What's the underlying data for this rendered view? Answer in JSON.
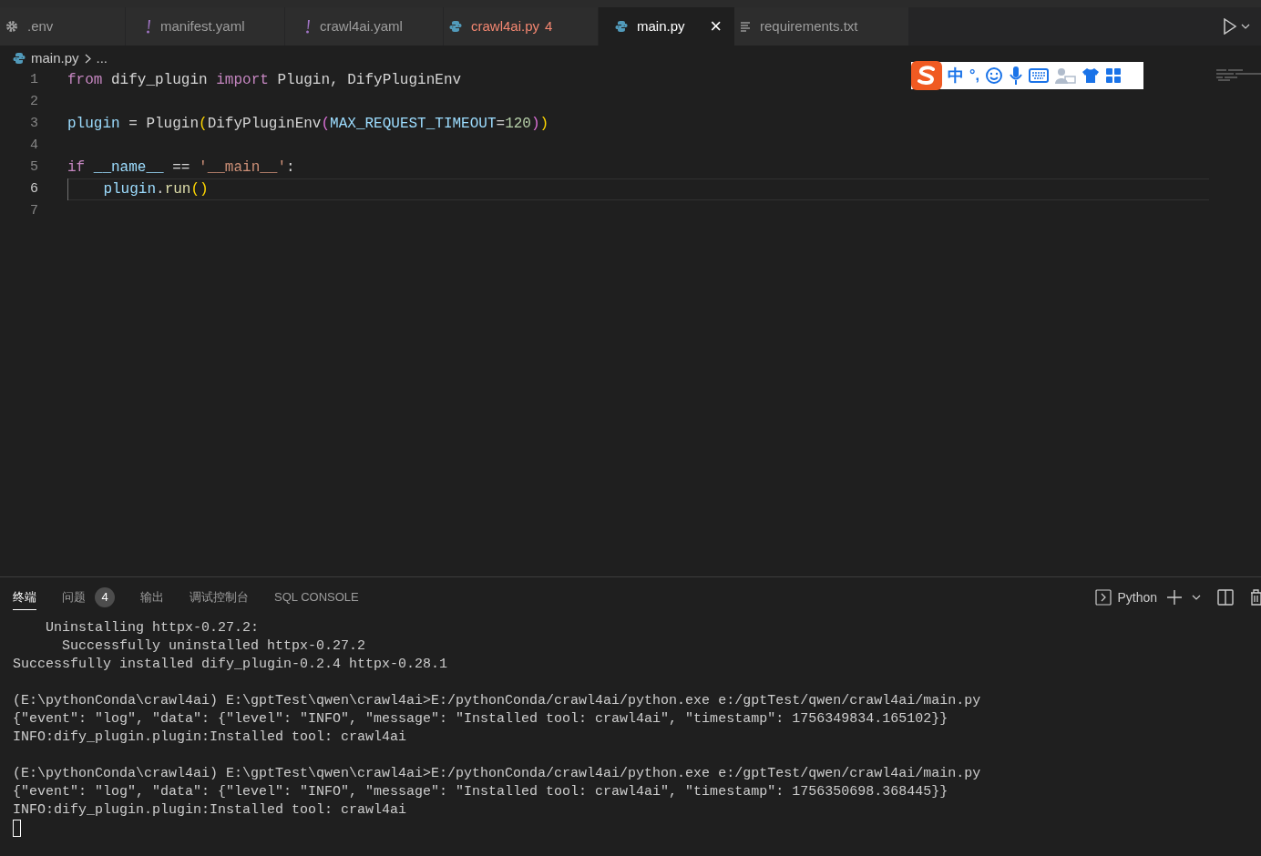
{
  "tabs": [
    {
      "label": ".env",
      "kind": "gear",
      "selected": false,
      "error": false
    },
    {
      "label": "manifest.yaml",
      "kind": "exclaim",
      "selected": false,
      "error": false
    },
    {
      "label": "crawl4ai.yaml",
      "kind": "exclaim",
      "selected": false,
      "error": false
    },
    {
      "label": "crawl4ai.py",
      "kind": "python",
      "selected": false,
      "error": true,
      "count": "4"
    },
    {
      "label": "main.py",
      "kind": "python",
      "selected": true,
      "error": false,
      "close": "×"
    },
    {
      "label": "requirements.txt",
      "kind": "lines",
      "selected": false,
      "error": false
    }
  ],
  "breadcrumb": {
    "file": "main.py",
    "rest": "..."
  },
  "code_lines": [
    {
      "number": "1",
      "current": false,
      "tokens": [
        {
          "kind": "keyword",
          "text": "from"
        },
        {
          "kind": "plain",
          "text": " dify_plugin "
        },
        {
          "kind": "keyword",
          "text": "import"
        },
        {
          "kind": "plain",
          "text": " Plugin, DifyPluginEnv"
        }
      ]
    },
    {
      "number": "2",
      "current": false
    },
    {
      "number": "3",
      "current": false,
      "tokens": [
        {
          "kind": "variable",
          "text": "plugin"
        },
        {
          "kind": "plain",
          "text": " = Plugin"
        },
        {
          "kind": "bracket1",
          "text": "("
        },
        {
          "kind": "plain",
          "text": "DifyPluginEnv"
        },
        {
          "kind": "bracket2",
          "text": "("
        },
        {
          "kind": "variable",
          "text": "MAX_REQUEST_TIMEOUT"
        },
        {
          "kind": "plain",
          "text": "="
        },
        {
          "kind": "number",
          "text": "120"
        },
        {
          "kind": "bracket2",
          "text": ")"
        },
        {
          "kind": "bracket1",
          "text": ")"
        }
      ]
    },
    {
      "number": "4",
      "current": false
    },
    {
      "number": "5",
      "current": false,
      "tokens": [
        {
          "kind": "keyword",
          "text": "if"
        },
        {
          "kind": "variable",
          "text": " __name__"
        },
        {
          "kind": "plain",
          "text": " == "
        },
        {
          "kind": "string",
          "text": "'__main__'"
        },
        {
          "kind": "plain",
          "text": ":"
        }
      ]
    },
    {
      "number": "6",
      "current": true,
      "tokens": [
        {
          "kind": "variable",
          "text": "    plugin"
        },
        {
          "kind": "plain",
          "text": "."
        },
        {
          "kind": "function",
          "text": "run"
        },
        {
          "kind": "bracket1",
          "text": "()"
        }
      ]
    },
    {
      "number": "7",
      "current": false
    }
  ],
  "ime_toolbar": {
    "mode": "中",
    "punctuation": "°,"
  },
  "panel_tabs": [
    {
      "label": "终端",
      "selected": true
    },
    {
      "label": "问题",
      "selected": false,
      "count": "4"
    },
    {
      "label": "输出",
      "selected": false
    },
    {
      "label": "调试控制台",
      "selected": false
    },
    {
      "label": "SQL CONSOLE",
      "selected": false
    }
  ],
  "terminal_profile": "Python",
  "terminal_blocks": [
    [
      "    Uninstalling httpx-0.27.2:",
      "      Successfully uninstalled httpx-0.27.2",
      "Successfully installed dify_plugin-0.2.4 httpx-0.28.1"
    ],
    [
      "(E:\\pythonConda\\crawl4ai) E:\\gptTest\\qwen\\crawl4ai>E:/pythonConda/crawl4ai/python.exe e:/gptTest/qwen/crawl4ai/main.py",
      "{\"event\": \"log\", \"data\": {\"level\": \"INFO\", \"message\": \"Installed tool: crawl4ai\", \"timestamp\": 1756349834.165102}}",
      "INFO:dify_plugin.plugin:Installed tool: crawl4ai"
    ],
    [
      "(E:\\pythonConda\\crawl4ai) E:\\gptTest\\qwen\\crawl4ai>E:/pythonConda/crawl4ai/python.exe e:/gptTest/qwen/crawl4ai/main.py",
      "{\"event\": \"log\", \"data\": {\"level\": \"INFO\", \"message\": \"Installed tool: crawl4ai\", \"timestamp\": 1756350698.368445}}",
      "INFO:dify_plugin.plugin:Installed tool: crawl4ai"
    ]
  ]
}
